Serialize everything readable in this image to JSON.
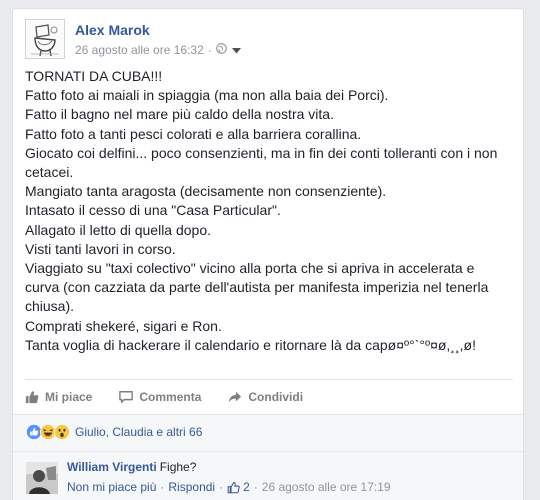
{
  "post": {
    "author": "Alex Marok",
    "timestamp": "26 agosto alle ore 16:32",
    "separator": "·",
    "privacy_icon": "globe-icon",
    "menu_icon": "chevron-down-icon",
    "lines": [
      "TORNATI DA CUBA!!!",
      "Fatto foto ai maiali in spiaggia (ma non alla baia dei Porci).",
      "Fatto il bagno nel mare più caldo della nostra vita.",
      "Fatto foto a tanti pesci colorati e alla barriera corallina.",
      "Giocato coi delfini... poco consenzienti, ma in fin dei conti tolleranti con i non",
      "cetacei.",
      "Mangiato tanta aragosta (decisamente non consenziente).",
      "Intasato il cesso di una \"Casa Particular\".",
      "Allagato il letto di quella dopo.",
      "Visti tanti lavori in corso.",
      "Viaggiato su \"taxi colectivo\" vicino alla porta che si apriva in accelerata e",
      "curva (con cazziata da parte dell'autista per manifesta imperizia nel tenerla",
      "chiusa).",
      "Comprati shekeré, sigari e Ron.",
      "Tanta voglia di hackerare il calendario e ritornare là da capø¤º°`°º¤ø,¸¸,ø!"
    ]
  },
  "actions": {
    "like": "Mi piace",
    "comment": "Commenta",
    "share": "Condividi"
  },
  "reactions": {
    "icons": [
      "like-reaction-icon",
      "haha-reaction-icon",
      "wow-reaction-icon"
    ],
    "summary": "Giulio, Claudia e altri 66"
  },
  "comment": {
    "author": "William Virgenti",
    "text": "Fighe?",
    "unlike": "Non mi piace più",
    "reply": "Rispondi",
    "like_count": "2",
    "timestamp": "26 agosto alle ore 17:19",
    "separator": "·"
  },
  "colors": {
    "link": "#365899",
    "meta": "#90949c",
    "like_blue": "#5890ff",
    "haha_yellow": "#f7c844"
  }
}
